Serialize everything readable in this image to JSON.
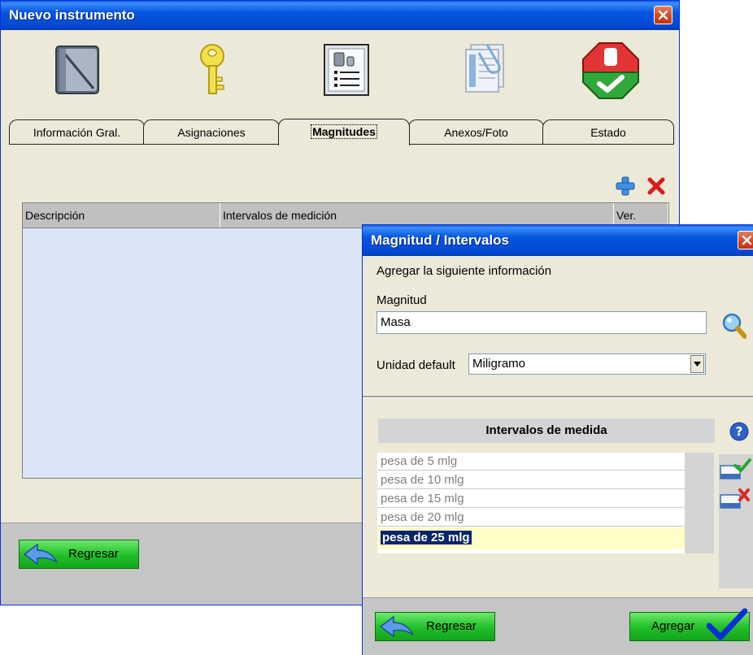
{
  "main_window": {
    "title": "Nuevo instrumento",
    "toolbar_icons": [
      "book-icon",
      "key-icon",
      "scale-weights-icon",
      "paperclip-documents-icon",
      "stop-check-icon"
    ],
    "tabs": [
      {
        "label": "Información Gral.",
        "active": false
      },
      {
        "label": "Asignaciones",
        "active": false
      },
      {
        "label": "Magnitudes",
        "active": true
      },
      {
        "label": "Anexos/Foto",
        "active": false
      },
      {
        "label": "Estado",
        "active": false
      }
    ],
    "grid": {
      "columns": [
        "Descripción",
        "Intervalos de medición",
        "Ver."
      ],
      "rows": []
    },
    "back_button_label": "Regresar"
  },
  "dialog": {
    "title": "Magnitud / Intervalos",
    "instruction": "Agregar la siguiente información",
    "magnitude_label": "Magnitud",
    "magnitude_value": "Masa",
    "unit_label": "Unidad default",
    "unit_value": "Miligramo",
    "intervals_title": "Intervalos de medida",
    "intervals": [
      "pesa de 5 mlg",
      "pesa de 10 mlg",
      "pesa de 15 mlg",
      "pesa de 20 mlg",
      "pesa de 25 mlg"
    ],
    "selected_interval": "pesa de 25 mlg",
    "back_button_label": "Regresar",
    "add_button_label": "Agregar"
  },
  "colors": {
    "title_bar": "#0555e0",
    "grid_background": "#dbe5f7",
    "button_green": "#1fbf26",
    "selection": "#0a246a"
  }
}
